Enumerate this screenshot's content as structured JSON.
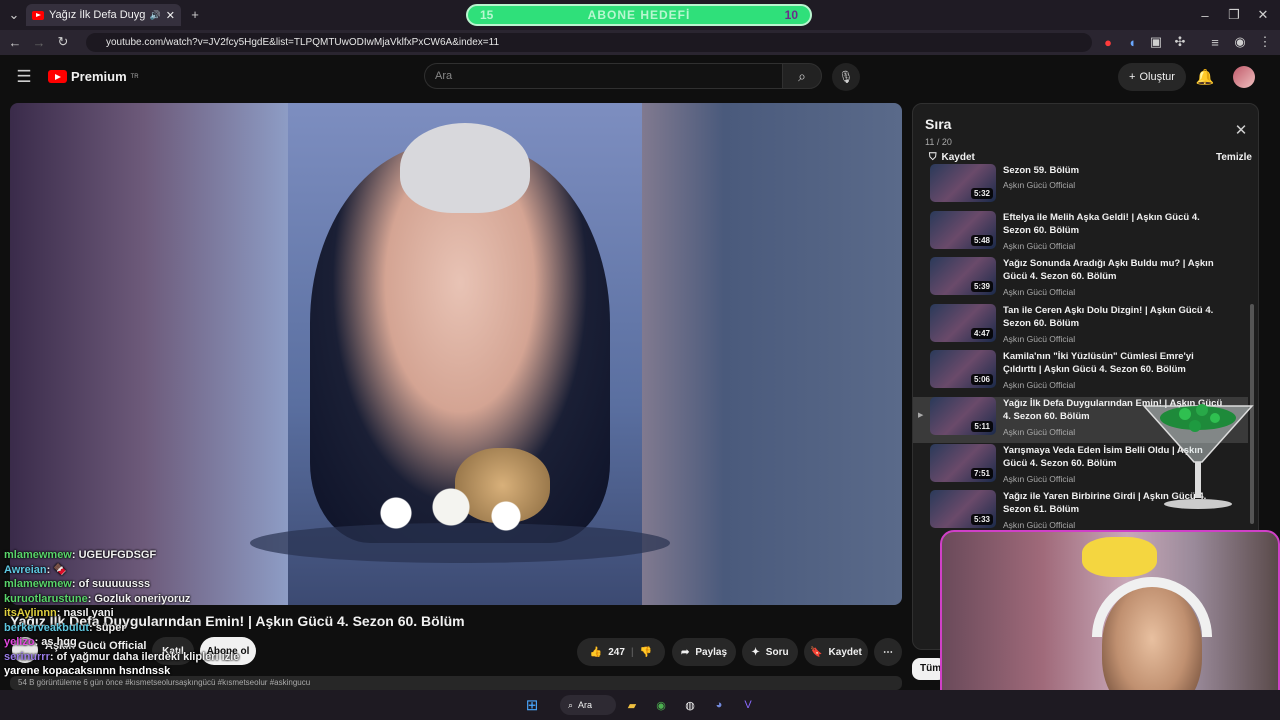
{
  "browser": {
    "tab_title": "Yağız İlk Defa Duygularından",
    "goal_left": "15",
    "goal_label": "ABONE HEDEFİ",
    "goal_right": "10",
    "url": "youtube.com/watch?v=JV2fcy5HgdE&list=TLPQMTUwODIwMjaVklfxPxCW6A&index=11"
  },
  "header": {
    "logo_text": "Premium",
    "logo_sup": "TR",
    "search_placeholder": "Ara",
    "create_label": "Oluştur"
  },
  "video": {
    "title": "Yağız İlk Defa Duygularından Emin! | Aşkın Gücü 4. Sezon 60. Bölüm",
    "channel": "Aşkın Gücü Official",
    "join_label": "Katıl",
    "subscribe_label": "Abone ol",
    "likes": "247",
    "share_label": "Paylaş",
    "ask_label": "Soru",
    "save_label": "Kaydet",
    "desc_hint": "54 B görüntüleme  6 gün önce  #kısmetseolursaşkıngücü #kısmetseolur #askingucu"
  },
  "chat": [
    {
      "user": "mlamewmew",
      "color": "#59d46a",
      "msg": ": UGEUFGDSGF"
    },
    {
      "user": "Awreian",
      "color": "#5ec7e0",
      "msg": ": 🍫"
    },
    {
      "user": "mlamewmew",
      "color": "#59d46a",
      "msg": ": of suuuuusss"
    },
    {
      "user": "kuruotlarustune",
      "color": "#59d46a",
      "msg": ": Gozluk oneriyoruz"
    },
    {
      "user": "itsAylinnn",
      "color": "#e0d040",
      "msg": ": nasıl yani"
    },
    {
      "user": "berkerveakbulut",
      "color": "#5ec7e0",
      "msg": ": süper"
    },
    {
      "user": "yelizo",
      "color": "#e44ae0",
      "msg": ": as hgg"
    },
    {
      "user": "serinurrr",
      "color": "#9a7ce8",
      "msg": ": of yağmur daha ilerdeki klipleri izle"
    },
    {
      "user": "yarene kopacaksınnn hsndnssk",
      "color": "#ffffff",
      "msg": ""
    }
  ],
  "playlist": {
    "title": "Sıra",
    "position": "11 / 20",
    "save_label": "Kaydet",
    "clear_label": "Temizle",
    "items": [
      {
        "title": "Sezon 59. Bölüm",
        "channel": "Aşkın Gücü Official",
        "duration": "5:32"
      },
      {
        "title": "Eftelya ile Melih Aşka Geldi! | Aşkın Gücü 4. Sezon 60. Bölüm",
        "channel": "Aşkın Gücü Official",
        "duration": "5:48"
      },
      {
        "title": "Yağız Sonunda Aradığı Aşkı Buldu mu? | Aşkın Gücü 4. Sezon 60. Bölüm",
        "channel": "Aşkın Gücü Official",
        "duration": "5:39"
      },
      {
        "title": "Tan ile Ceren Aşkı Dolu Dizgin! | Aşkın Gücü 4. Sezon 60. Bölüm",
        "channel": "Aşkın Gücü Official",
        "duration": "4:47"
      },
      {
        "title": "Kamila'nın \"İki Yüzlüsün\" Cümlesi Emre'yi Çıldırttı | Aşkın Gücü 4. Sezon 60. Bölüm",
        "channel": "Aşkın Gücü Official",
        "duration": "5:06"
      },
      {
        "title": "Yağız İlk Defa Duygularından Emin! | Aşkın Gücü 4. Sezon 60. Bölüm",
        "channel": "Aşkın Gücü Official",
        "duration": "5:11"
      },
      {
        "title": "Yarışmaya Veda Eden İsim Belli Oldu | Aşkın Gücü 4. Sezon 60. Bölüm",
        "channel": "Aşkın Gücü Official",
        "duration": "7:51"
      },
      {
        "title": "Yağız ile Yaren Birbirine Girdi | Aşkın Gücü 4. Sezon 61. Bölüm",
        "channel": "Aşkın Gücü Official",
        "duration": "5:33"
      }
    ],
    "chip": "Tüm"
  },
  "taskbar": {
    "search_label": "Ara"
  }
}
